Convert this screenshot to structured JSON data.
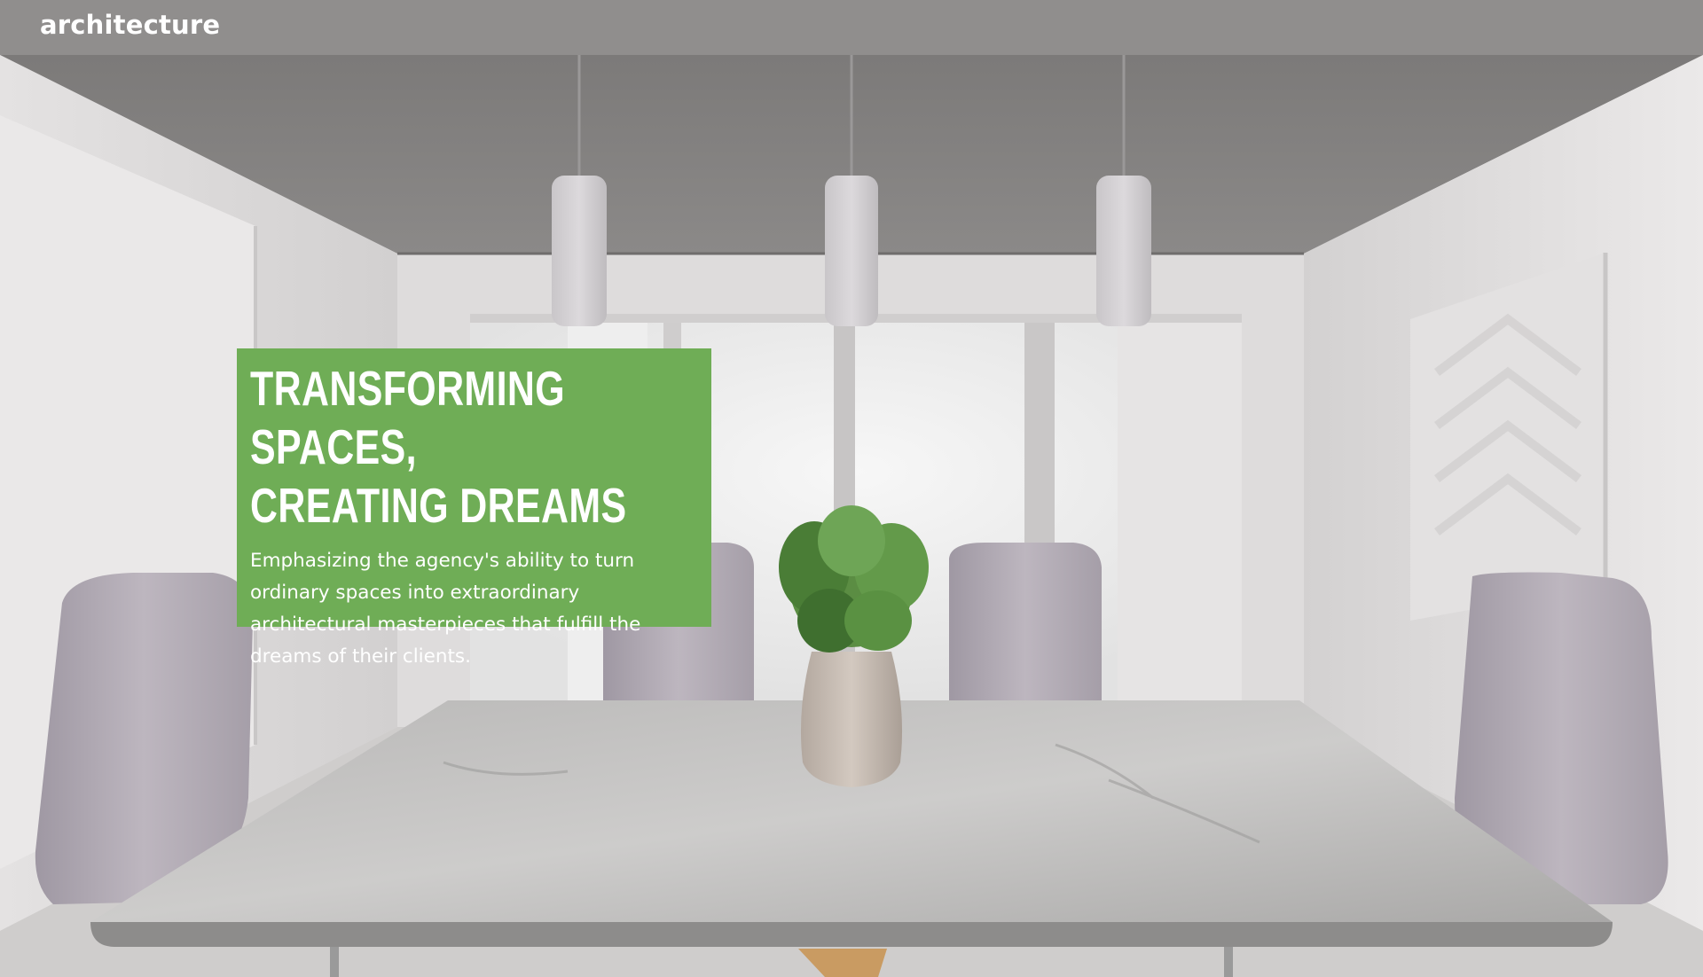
{
  "header": {
    "brand": "architecture"
  },
  "hero": {
    "title_line1": "TRANSFORMING SPACES,",
    "title_line2": "CREATING DREAMS",
    "description": "Emphasizing the agency's ability to turn ordinary spaces into extraordinary architectural masterpieces that fulfill the dreams of their clients."
  },
  "colors": {
    "hero_box": "#6fad56",
    "header_bar": "#8a8886",
    "text": "#ffffff"
  }
}
